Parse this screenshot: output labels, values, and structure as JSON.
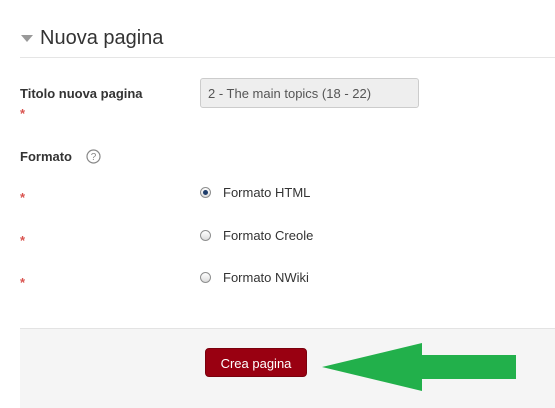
{
  "section": {
    "title": "Nuova pagina"
  },
  "form": {
    "title_field": {
      "label": "Titolo nuova pagina",
      "value": "2 - The main topics (18 - 22)",
      "required_marker": "*"
    },
    "format": {
      "label": "Formato",
      "options": [
        {
          "label": "Formato HTML",
          "checked": true,
          "required_marker": "*"
        },
        {
          "label": "Formato Creole",
          "checked": false,
          "required_marker": "*"
        },
        {
          "label": "Formato NWiki",
          "checked": false,
          "required_marker": "*"
        }
      ]
    },
    "submit_label": "Crea pagina"
  },
  "colors": {
    "button": "#990011",
    "required": "#d9534f",
    "arrow": "#22b04b"
  },
  "icons": {
    "collapse": "triangle-down-icon",
    "help": "question-circle-icon",
    "annotation": "arrow-left-icon"
  }
}
